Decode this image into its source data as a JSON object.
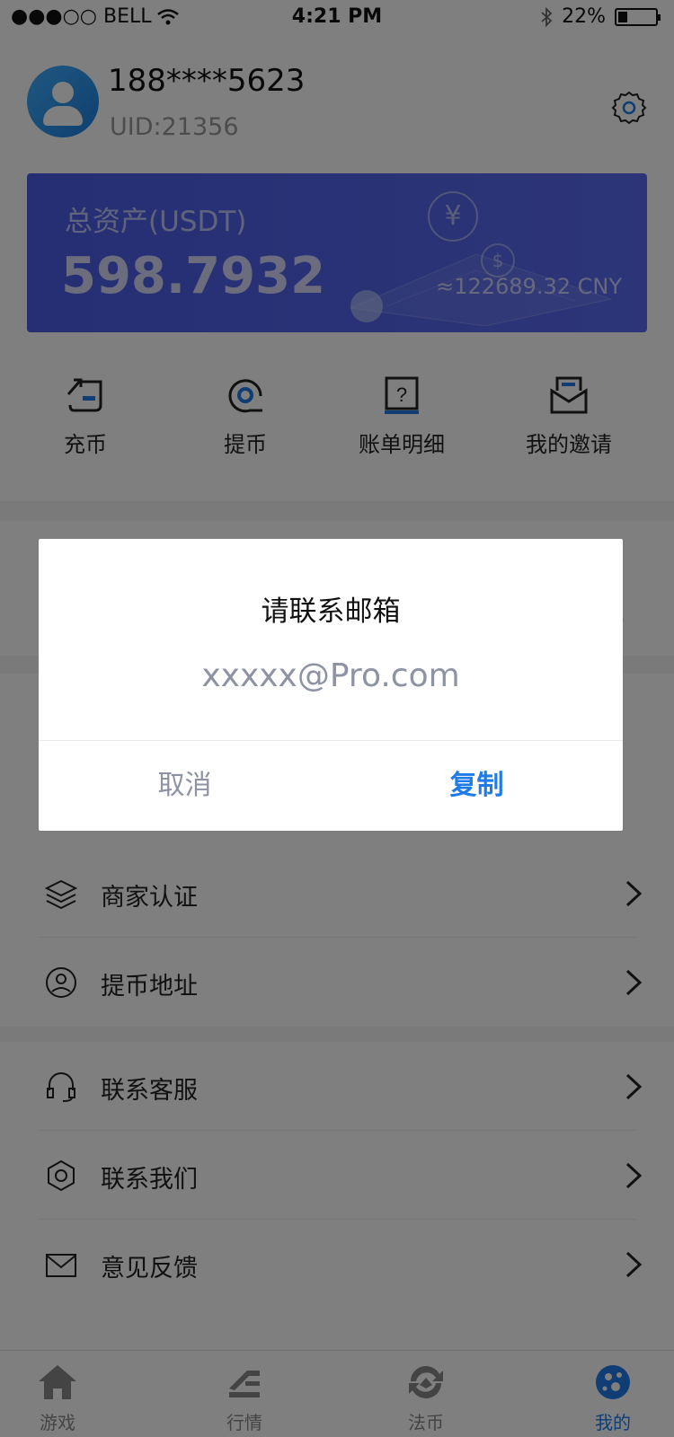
{
  "status_bar": {
    "carrier": "●●●○○ BELL",
    "time": "4:21 PM",
    "battery": "22%"
  },
  "profile": {
    "phone": "188****5623",
    "uid": "UID:21356"
  },
  "asset_card": {
    "label": "总资产(USDT)",
    "value": "598.7932",
    "cny": "≈122689.32 CNY"
  },
  "actions": [
    {
      "label": "充币",
      "icon": "deposit-icon"
    },
    {
      "label": "提币",
      "icon": "withdraw-icon"
    },
    {
      "label": "账单明细",
      "icon": "bill-icon"
    },
    {
      "label": "我的邀请",
      "icon": "invite-icon"
    }
  ],
  "menu": [
    {
      "label": "商家认证",
      "icon": "layers-icon"
    },
    {
      "label": "提币地址",
      "icon": "location-icon"
    },
    {
      "label": "联系客服",
      "icon": "headset-icon"
    },
    {
      "label": "联系我们",
      "icon": "hexagon-icon"
    },
    {
      "label": "意见反馈",
      "icon": "mail-icon"
    }
  ],
  "tabbar": [
    {
      "label": "游戏",
      "icon": "home-icon",
      "active": false
    },
    {
      "label": "行情",
      "icon": "market-icon",
      "active": false
    },
    {
      "label": "法币",
      "icon": "exchange-icon",
      "active": false
    },
    {
      "label": "我的",
      "icon": "profile-icon",
      "active": true
    }
  ],
  "dialog": {
    "title": "请联系邮箱",
    "email": "xxxxx@Pro.com",
    "cancel_label": "取消",
    "copy_label": "复制"
  },
  "colors": {
    "accent": "#1f7be8",
    "card": "#4c5ee8",
    "mask": "rgba(0,0,0,0.5)"
  }
}
